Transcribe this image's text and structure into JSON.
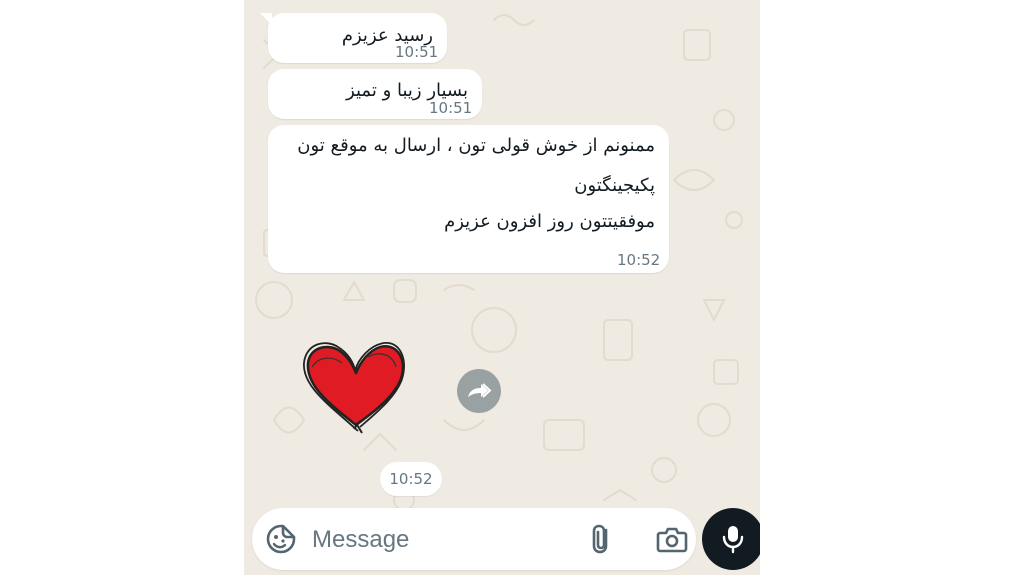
{
  "messages": [
    {
      "text": "رسید عزیزم",
      "time": "10:51"
    },
    {
      "text": "بسیار زیبا و تمیز",
      "time": "10:51"
    },
    {
      "lines": [
        "ممنونم از خوش قولی تون ، ارسال به موقع تون",
        "پکیجینگتون",
        "موفقیتتون روز افزون عزیزم"
      ],
      "time": "10:52"
    }
  ],
  "sticker": {
    "icon": "red-heart-sticker",
    "time": "10:52"
  },
  "composer": {
    "placeholder": "Message"
  },
  "colors": {
    "wallpaper": "#efeae2",
    "bubble": "#ffffff",
    "mic_button": "#111b21",
    "heart": "#e01b24"
  }
}
